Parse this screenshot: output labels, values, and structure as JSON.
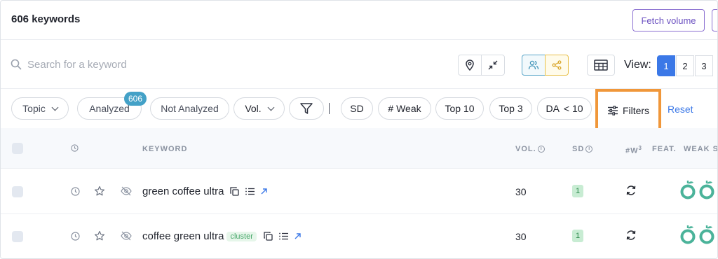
{
  "header": {
    "keyword_count": "606 keywords",
    "fetch_volume_label": "Fetch volume"
  },
  "search": {
    "placeholder": "Search for a keyword",
    "view_label": "View:",
    "view_options": [
      "1",
      "2",
      "3"
    ],
    "view_selected": "1"
  },
  "filters": {
    "topic": "Topic",
    "analyzed": "Analyzed",
    "analyzed_badge": "606",
    "not_analyzed": "Not Analyzed",
    "vol": "Vol.",
    "sd": "SD",
    "weak": "# Weak",
    "top10": "Top 10",
    "top3": "Top 3",
    "da": "DA",
    "da_op": "< 10",
    "filters_label": "Filters",
    "reset": "Reset"
  },
  "table": {
    "headers": {
      "keyword": "KEYWORD",
      "vol": "VOL.",
      "sd": "SD",
      "w": "#W",
      "w_sup": "3",
      "feat": "FEAT.",
      "weak": "WEAK SI"
    },
    "rows": [
      {
        "keyword": "green coffee ultra",
        "tag": "",
        "vol": "30",
        "sd": "1"
      },
      {
        "keyword": "coffee green ultra",
        "tag": "cluster",
        "vol": "30",
        "sd": "1"
      }
    ]
  },
  "colors": {
    "accent_blue": "#3b78e7",
    "highlight_orange": "#f0973a",
    "badge_teal": "#43a1c7",
    "weak_green": "#4bb39a"
  }
}
